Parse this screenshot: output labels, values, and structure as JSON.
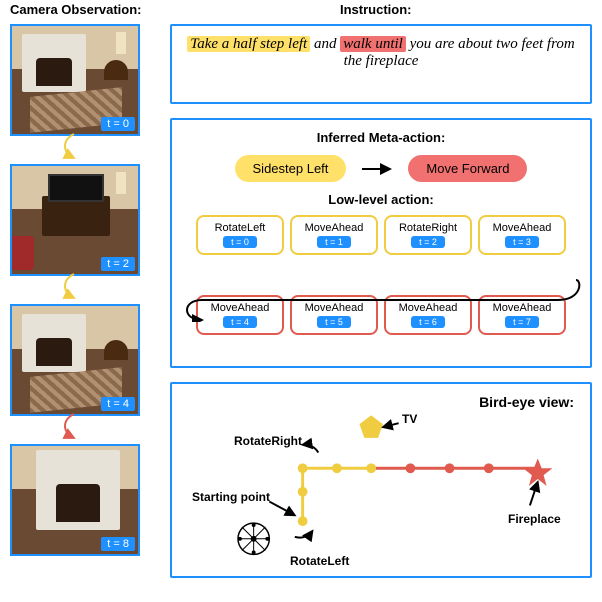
{
  "headers": {
    "camera": "Camera Observation:",
    "instruction": "Instruction:"
  },
  "instruction": {
    "part1_hl": "Take a half step left",
    "part2": " and ",
    "part3_hl": "walk until",
    "part4": " you are about two feet from the fireplace"
  },
  "meta": {
    "title": "Inferred Meta-action:",
    "leftPill": "Sidestep Left",
    "rightPill": "Move Forward",
    "loTitle": "Low-level action:",
    "row1": [
      {
        "name": "RotateLeft",
        "t": "t = 0",
        "color": "yellow"
      },
      {
        "name": "MoveAhead",
        "t": "t = 1",
        "color": "yellow"
      },
      {
        "name": "RotateRight",
        "t": "t = 2",
        "color": "yellow"
      },
      {
        "name": "MoveAhead",
        "t": "t = 3",
        "color": "yellow"
      }
    ],
    "row2": [
      {
        "name": "MoveAhead",
        "t": "t = 4",
        "color": "red"
      },
      {
        "name": "MoveAhead",
        "t": "t = 5",
        "color": "red"
      },
      {
        "name": "MoveAhead",
        "t": "t = 6",
        "color": "red"
      },
      {
        "name": "MoveAhead",
        "t": "t = 7",
        "color": "red"
      }
    ]
  },
  "birdeye": {
    "title": "Bird-eye view:",
    "labels": {
      "tv": "TV",
      "rotR": "RotateRight",
      "start": "Starting point",
      "rotL": "RotateLeft",
      "fire": "Fireplace"
    }
  },
  "frames": [
    {
      "t": "t = 0",
      "arrowColor": "#f0cc40"
    },
    {
      "t": "t = 2",
      "arrowColor": "#f0cc40"
    },
    {
      "t": "t = 4",
      "arrowColor": "#e05a50"
    },
    {
      "t": "t = 8"
    }
  ],
  "colors": {
    "blue": "#1e90ff",
    "yellow": "#ffe16a",
    "yellowBorder": "#f0cc40",
    "red": "#f17070",
    "redBorder": "#e05a50"
  }
}
